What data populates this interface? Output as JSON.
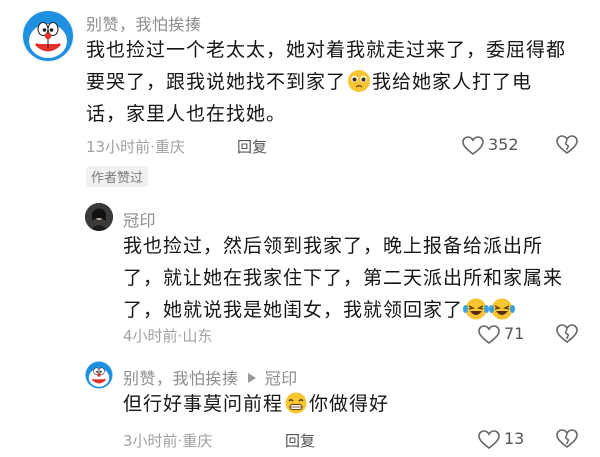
{
  "comments": [
    {
      "username": "别赞，我怕挨揍",
      "text_parts": [
        "我也捡过一个老太太，她对着我就走过来了，委屈得都要哭了，跟我说她找不到家了",
        "我给她家人打了电话，家里人也在找她。"
      ],
      "emojis": [
        "pleading-face-icon"
      ],
      "time": "13小时前",
      "location": "重庆",
      "reply_label": "回复",
      "like_count": "352",
      "badge": "作者赞过"
    }
  ],
  "replies": [
    {
      "username": "冠印",
      "text_parts": [
        "我也捡过，然后领到我家了，晚上报备给派出所了，就让她在我家住下了，第二天派出所和家属来了，她就说我是她闺女，我就领回家了"
      ],
      "emojis": [
        "laughing-tears-icon",
        "laughing-tears-icon"
      ],
      "time": "4小时前",
      "location": "山东",
      "like_count": "71"
    },
    {
      "username": "别赞，我怕挨揍",
      "reply_to": "冠印",
      "text_parts": [
        "但行好事莫问前程",
        "你做得好"
      ],
      "emojis": [
        "grinning-face-icon"
      ],
      "time": "3小时前",
      "location": "重庆",
      "reply_label": "回复",
      "like_count": "13"
    }
  ],
  "separator": "·",
  "colors": {
    "muted": "#a2a2a2",
    "text": "#161616",
    "emoji_yellow": "#f7c532",
    "emoji_blue": "#3aa0e6",
    "doraemon_blue": "#1f8fe0"
  }
}
